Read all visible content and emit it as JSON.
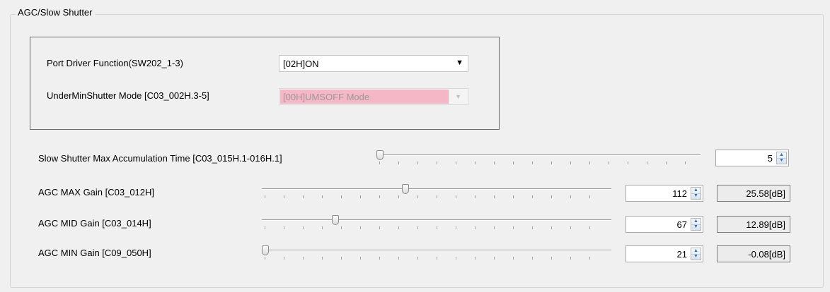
{
  "group": {
    "title": "AGC/Slow Shutter"
  },
  "port_driver": {
    "label": "Port Driver Function(SW202_1-3)",
    "value": "[02H]ON"
  },
  "under_min_shutter": {
    "label": "UnderMinShutter Mode [C03_002H.3-5]",
    "value": "[00H]UMSOFF Mode",
    "highlight_color": "#f5b6c6"
  },
  "slow_shutter": {
    "label": "Slow Shutter Max Accumulation Time [C03_015H.1-016H.1]",
    "value": "5"
  },
  "agc_max": {
    "label": "AGC MAX Gain [C03_012H]",
    "value": "112",
    "db": "25.58[dB]"
  },
  "agc_mid": {
    "label": "AGC MID Gain [C03_014H]",
    "value": "67",
    "db": "12.89[dB]"
  },
  "agc_min": {
    "label": "AGC MIN Gain [C09_050H]",
    "value": "21",
    "db": "-0.08[dB]"
  },
  "icons": {
    "dropdown": "▼",
    "spin_up": "▲",
    "spin_down": "▼"
  }
}
